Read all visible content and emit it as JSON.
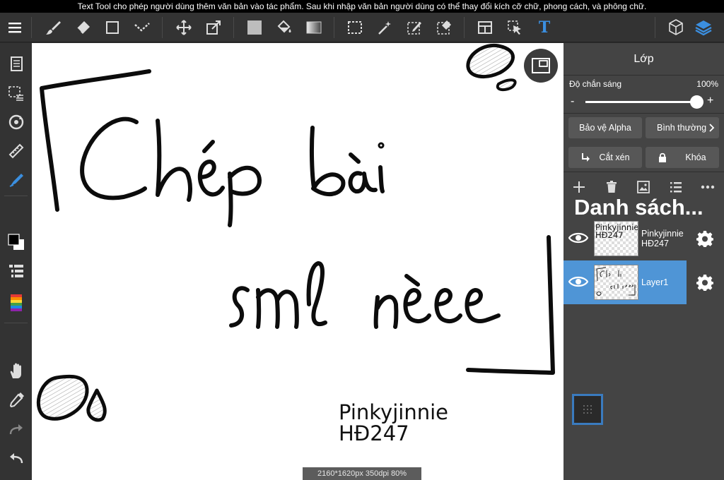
{
  "hint": "Text Tool cho phép người dùng thêm văn bản vào tác phẩm. Sau khi nhập văn bản người dùng có thể thay đổi kích cỡ chữ, phong cách, và phông chữ.",
  "toolbar": {
    "icons": [
      "menu-icon",
      "brush-icon",
      "eraser-icon",
      "rectangle-icon",
      "selection-dots-icon",
      "move-icon",
      "transform-icon",
      "fill-color-icon",
      "bucket-icon",
      "gradient-icon",
      "select-rect-icon",
      "magic-wand-icon",
      "select-pen-icon",
      "select-eraser-icon",
      "layout-icon",
      "select-arrow-icon",
      "text-icon",
      "3d-cube-icon",
      "layers-icon"
    ],
    "text_tool_glyph": "T"
  },
  "canvas": {
    "text_line1": "Pinkyjinnie",
    "text_line2": "HĐ247",
    "status": "2160*1620px 350dpi 80%"
  },
  "layers_panel": {
    "title": "Lớp",
    "opacity_label": "Độ chắn sáng",
    "opacity_value": "100%",
    "opacity_fraction": 1.0,
    "minus": "-",
    "plus": "+",
    "alpha_button": "Bảo vệ Alpha",
    "blend_button": "Bình thường",
    "clip_button": "Cắt xén",
    "lock_button": "Khóa",
    "list_heading": "Danh sách...",
    "layers": [
      {
        "name": "Pinkyjinnie HĐ247",
        "name_line1": "Pinkyjinnie",
        "name_line2": "HĐ247",
        "selected": false
      },
      {
        "name": "Layer1",
        "selected": true
      }
    ],
    "thumb_text_line1": "Pinkyjinnie",
    "thumb_text_line2": "HĐ247"
  },
  "colors": {
    "accent": "#4f95d6",
    "panel": "#444444",
    "toolbar": "#333333",
    "text_tool_active": "#3b8fe0"
  }
}
